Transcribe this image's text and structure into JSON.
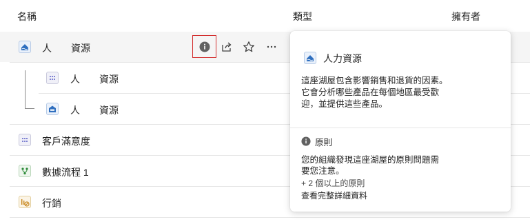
{
  "columns": {
    "name": "名稱",
    "type": "類型",
    "owner": "擁有者"
  },
  "rows": [
    {
      "name": "人　　資源",
      "icon": "lakehouse-icon"
    },
    {
      "name": "人　　資源",
      "icon": "dataset-icon"
    },
    {
      "name": "人　　資源",
      "icon": "warehouse-icon"
    },
    {
      "name": "客戶滿意度",
      "icon": "dataset-icon"
    },
    {
      "name": "數據流程 1",
      "icon": "dataflow-icon"
    },
    {
      "name": "行銷",
      "icon": "report-icon"
    }
  ],
  "row_actions": [
    "info-icon",
    "share-icon",
    "star-icon",
    "more-icon"
  ],
  "card": {
    "title": "人力資源",
    "description": "這座湖屋包含影響銷售和退貨的因素。它會分析哪些產品在每個地區最受歡迎，並提供這些產品。",
    "policy_title": "原則",
    "policy_text": "您的組織發現這座湖屋的原則問題需要您注意。",
    "more_policies": "+ 2 個以上的原則",
    "details_link": "查看完整詳細資料"
  },
  "colors": {
    "accent": "#2f6fbf",
    "highlight_box": "#d32f2f",
    "row_hover": "#f5f5f5"
  }
}
